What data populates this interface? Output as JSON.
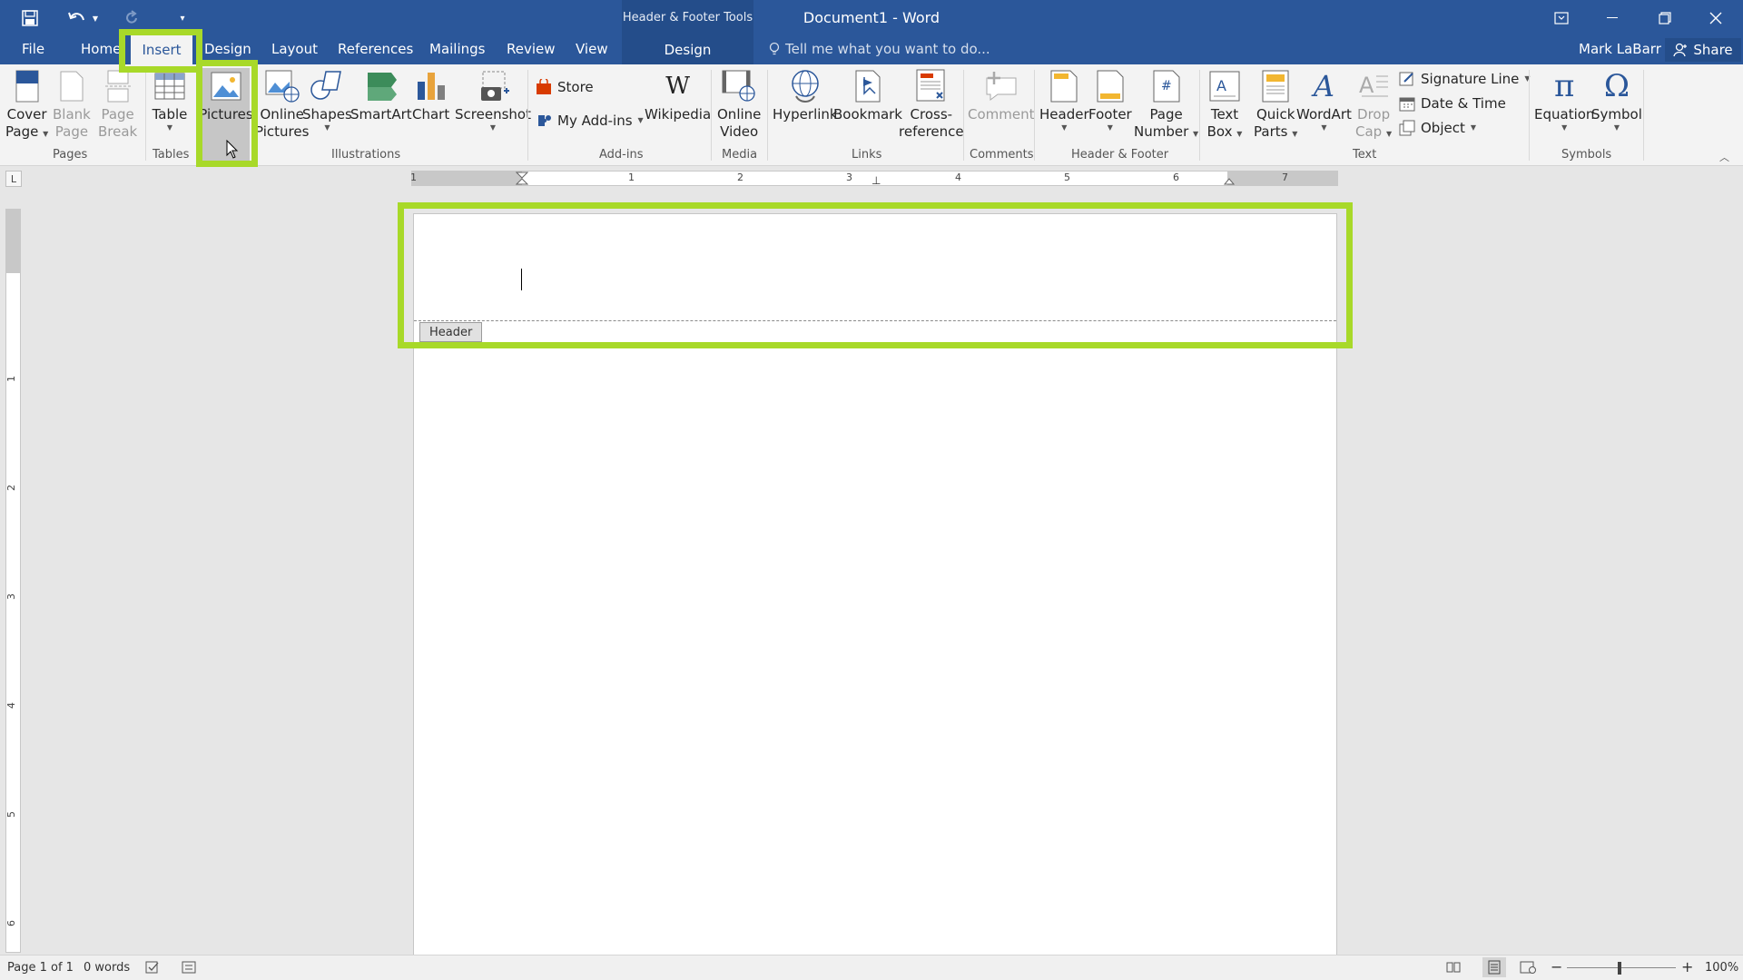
{
  "titlebar": {
    "context_title": "Header & Footer Tools",
    "doc_title": "Document1 - Word",
    "qat": [
      "save-icon",
      "undo-icon",
      "redo-icon",
      "customize-icon"
    ]
  },
  "tabs": {
    "file": "File",
    "home": "Home",
    "insert": "Insert",
    "design": "Design",
    "layout": "Layout",
    "references": "References",
    "mailings": "Mailings",
    "review": "Review",
    "view": "View",
    "design_ctx": "Design"
  },
  "tellme_placeholder": "Tell me what you want to do...",
  "user": {
    "name": "Mark LaBarr",
    "share": "Share"
  },
  "ribbon": {
    "pages": {
      "cover_l1": "Cover",
      "cover_l2": "Page",
      "blank_l1": "Blank",
      "blank_l2": "Page",
      "break_l1": "Page",
      "break_l2": "Break",
      "label": "Pages"
    },
    "tables": {
      "table": "Table",
      "label": "Tables"
    },
    "illustrations": {
      "pictures": "Pictures",
      "online_l1": "Online",
      "online_l2": "Pictures",
      "shapes": "Shapes",
      "smartart": "SmartArt",
      "chart": "Chart",
      "screenshot": "Screenshot",
      "label": "Illustrations"
    },
    "addins": {
      "store": "Store",
      "myaddins": "My Add-ins",
      "wikipedia": "Wikipedia",
      "label": "Add-ins"
    },
    "media": {
      "video_l1": "Online",
      "video_l2": "Video",
      "label": "Media"
    },
    "links": {
      "hyperlink": "Hyperlink",
      "bookmark": "Bookmark",
      "cross_l1": "Cross-",
      "cross_l2": "reference",
      "label": "Links"
    },
    "comments": {
      "comment": "Comment",
      "label": "Comments"
    },
    "hf": {
      "header": "Header",
      "footer": "Footer",
      "pn_l1": "Page",
      "pn_l2": "Number",
      "label": "Header & Footer"
    },
    "text": {
      "tb_l1": "Text",
      "tb_l2": "Box",
      "qp_l1": "Quick",
      "qp_l2": "Parts",
      "wordart": "WordArt",
      "dc_l1": "Drop",
      "dc_l2": "Cap",
      "sigline": "Signature Line",
      "datetime": "Date & Time",
      "object": "Object",
      "label": "Text"
    },
    "symbols": {
      "equation": "Equation",
      "symbol": "Symbol",
      "label": "Symbols"
    }
  },
  "ruler": {
    "h_numbers": [
      "1",
      "1",
      "2",
      "3",
      "4",
      "5",
      "6",
      "7"
    ],
    "v_numbers": [
      "1",
      "2",
      "3",
      "4",
      "5",
      "6"
    ]
  },
  "document": {
    "header_tag": "Header"
  },
  "status": {
    "page": "Page 1 of 1",
    "words": "0 words",
    "zoom": "100%"
  },
  "colors": {
    "accent": "#2b579a",
    "highlight": "#a8d929"
  }
}
